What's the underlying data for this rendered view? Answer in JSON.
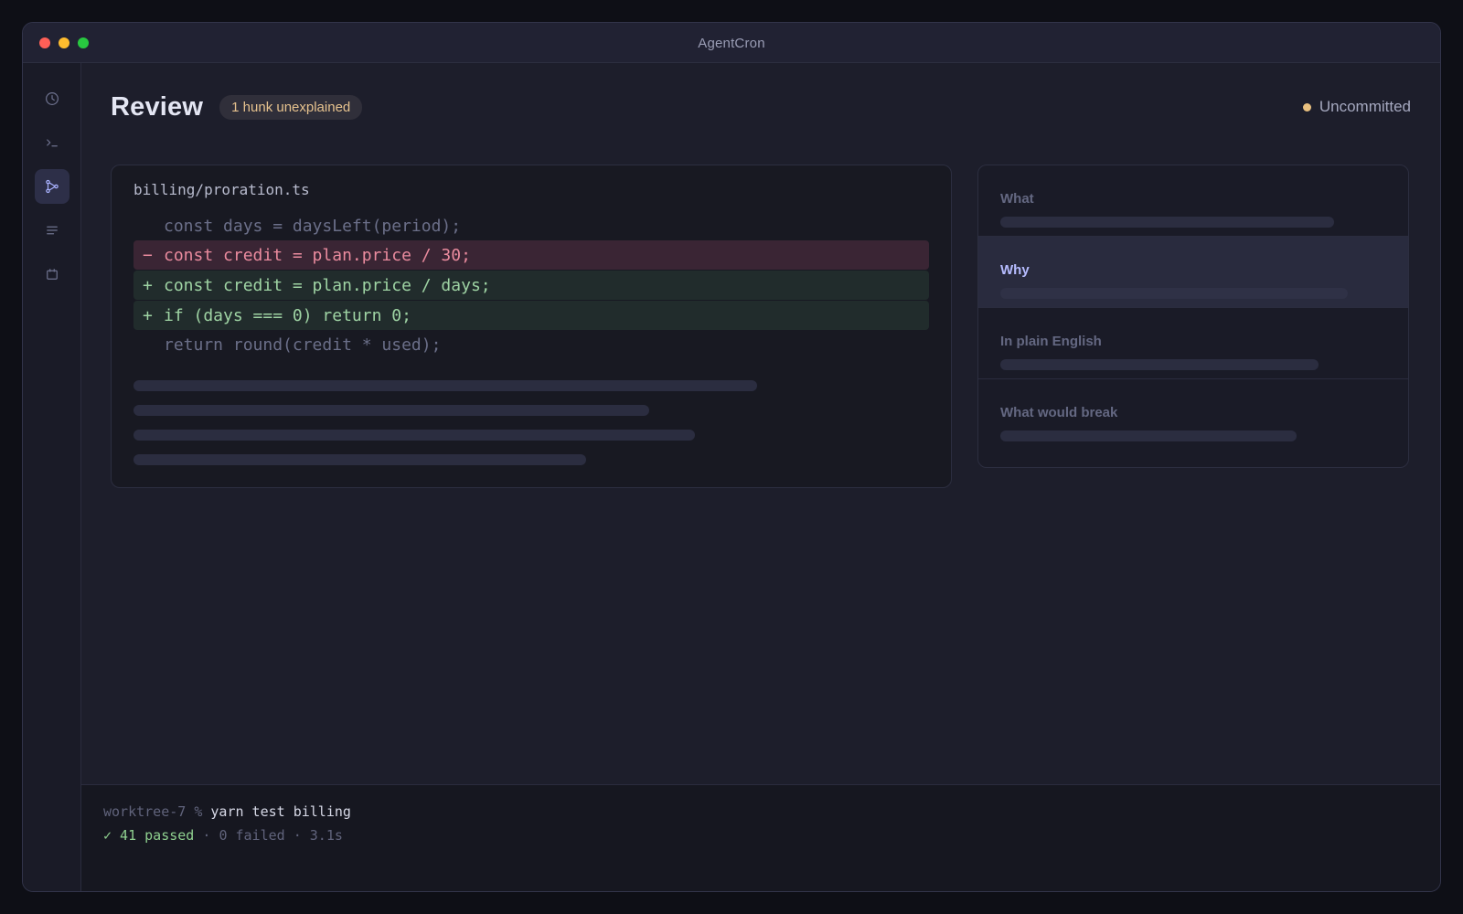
{
  "window": {
    "title": "AgentCron"
  },
  "sidebar": {
    "items": [
      {
        "name": "history",
        "icon": "clock-icon",
        "active": false
      },
      {
        "name": "terminal",
        "icon": "terminal-icon",
        "active": false
      },
      {
        "name": "review",
        "icon": "git-branch-icon",
        "active": true
      },
      {
        "name": "log",
        "icon": "list-icon",
        "active": false
      },
      {
        "name": "schedule",
        "icon": "calendar-icon",
        "active": false
      }
    ]
  },
  "header": {
    "title": "Review",
    "badge": "1 hunk unexplained",
    "status": "Uncommitted",
    "status_color": "#e9c07f"
  },
  "diff": {
    "file": "billing/proration.ts",
    "lines": [
      {
        "type": "context",
        "sign": "",
        "code": "const days = daysLeft(period);"
      },
      {
        "type": "del",
        "sign": "−",
        "code": "const credit = plan.price / 30;"
      },
      {
        "type": "add",
        "sign": "+",
        "code": "const credit = plan.price / days;"
      },
      {
        "type": "add",
        "sign": "+",
        "code": "if (days === 0) return 0;"
      },
      {
        "type": "context",
        "sign": "",
        "code": "return round(credit * used);"
      }
    ]
  },
  "explain": {
    "sections": [
      {
        "label": "What",
        "active": false
      },
      {
        "label": "Why",
        "active": true
      },
      {
        "label": "In plain English",
        "active": false
      },
      {
        "label": "What would break",
        "active": false
      }
    ]
  },
  "terminal": {
    "prompt": "worktree-7 %",
    "command": "yarn test billing",
    "passed": "✓ 41 passed",
    "sep1": "·",
    "failed": "0 failed",
    "sep2": "·",
    "duration": "3.1s"
  }
}
